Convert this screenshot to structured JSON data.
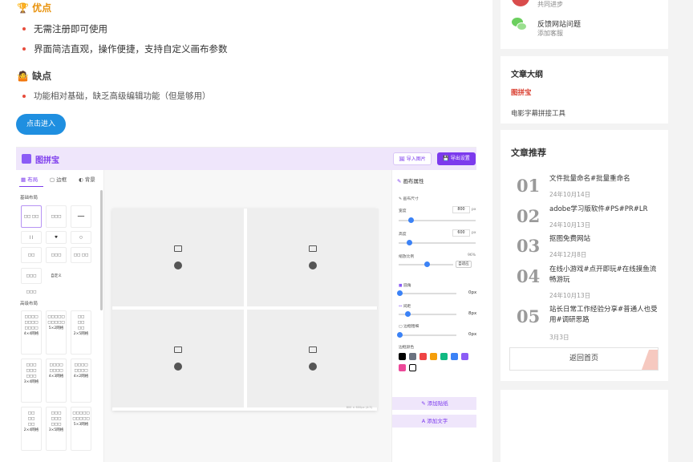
{
  "article": {
    "pros_title": "优点",
    "pros": [
      "无需注册即可使用",
      "界面简洁直观，操作便捷，支持自定义画布参数"
    ],
    "cons_title": "缺点",
    "cons": [
      "功能相对基础，缺乏高级编辑功能（但是够用）"
    ],
    "enter_button": "点击进入"
  },
  "app": {
    "title": "图拼宝",
    "import_button": "导入图片",
    "export_button": "导出设置",
    "tabs": [
      "布局",
      "边框",
      "背景"
    ],
    "basic_layout_label": "基础布局",
    "basic_tiles": [
      "□□ □□",
      "□□□ □□□",
      "━━━",
      "| |",
      "♥",
      "○",
      "□□",
      "□□□ □□□",
      "□□ □□",
      "□□□ □□□",
      "自定义"
    ],
    "advanced_layout_label": "高级布局",
    "advanced_tiles": [
      "4×4网格",
      "5×2网格",
      "2×5网格",
      "3×4网格",
      "4×3网格",
      "4×2网格",
      "2×4网格",
      "3×5网格",
      "5×3网格"
    ],
    "canvas_size_note": "800 × 600px (4:3)",
    "panel_title": "画布属性",
    "canvas_size_label": "画布尺寸",
    "width_label": "宽度",
    "width_value": "800",
    "height_label": "高度",
    "height_value": "600",
    "unit": "px",
    "zoom_label": "缩放比例",
    "zoom_value": "96%",
    "fit_button": "自适应",
    "radius_label": "圆角",
    "radius_value": "0px",
    "gap_label": "间距",
    "gap_value": "8px",
    "border_label": "边框粗细",
    "border_value": "0px",
    "border_color_label": "边框颜色",
    "colors": [
      "#000000",
      "#6b7280",
      "#ef4444",
      "#f59e0b",
      "#10b981",
      "#3b82f6",
      "#8b5cf6",
      "#ec4899",
      "#ffffff"
    ],
    "add_sticker": "添加贴纸",
    "add_text": "添加文字"
  },
  "sidebar": {
    "top_desc": "共同进步",
    "feedback_title": "反馈网站问题",
    "feedback_sub": "添加客服",
    "outline_title": "文章大纲",
    "outline": [
      "图拼宝",
      "电影字幕拼接工具"
    ],
    "recommend_title": "文章推荐",
    "recommendations": [
      {
        "num": "01",
        "title": "文件批量命名#批量重命名",
        "date": "24年10月14日"
      },
      {
        "num": "02",
        "title": "adobe学习版软件#PS#PR#LR",
        "date": "24年10月13日"
      },
      {
        "num": "03",
        "title": "抠图免费网站",
        "date": "24年12月8日"
      },
      {
        "num": "04",
        "title": "在线小游戏#点开即玩#在线摸鱼流畅游玩",
        "date": "24年10月13日"
      },
      {
        "num": "05",
        "title": "站长日常工作经验分享#普通人也受用#调研思路",
        "date": "3月3日"
      }
    ],
    "home_button": "返回首页"
  }
}
